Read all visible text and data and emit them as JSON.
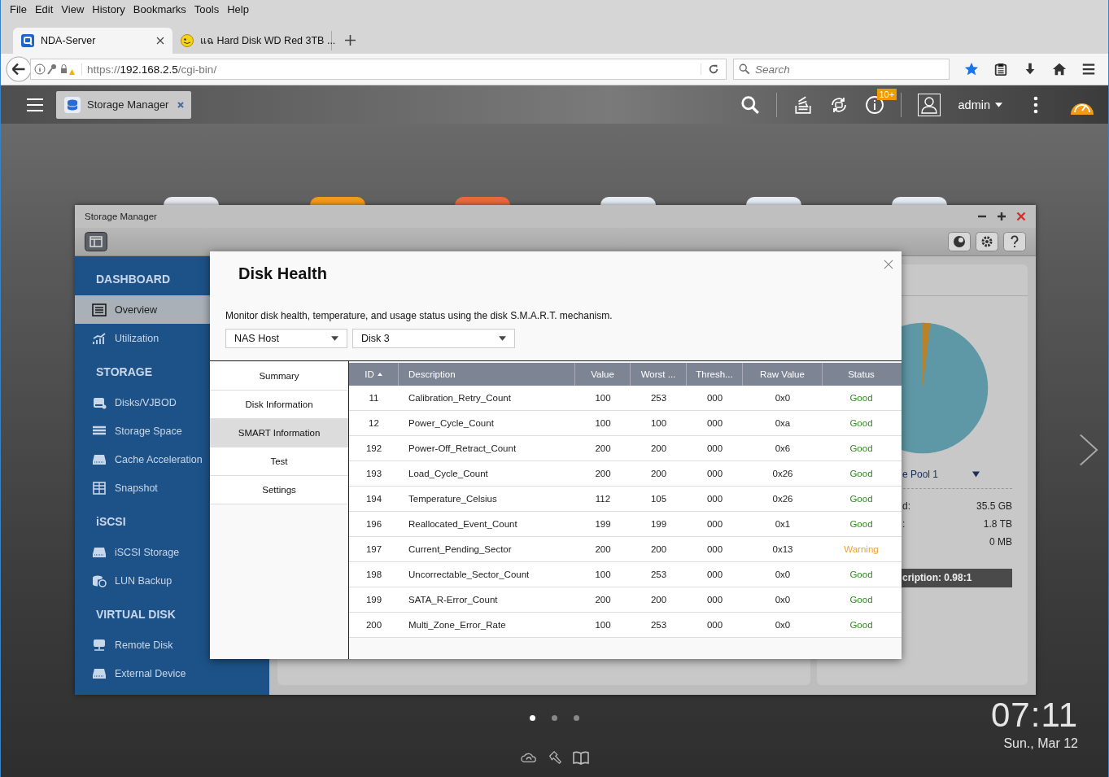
{
  "browser": {
    "menu": [
      "File",
      "Edit",
      "View",
      "History",
      "Bookmarks",
      "Tools",
      "Help"
    ],
    "tabs": [
      {
        "title": "NDA-Server",
        "selected": true
      },
      {
        "title": "แฉ Hard Disk WD Red 3TB ...",
        "selected": false
      }
    ],
    "url_scheme": "https://",
    "url_host": "192.168.2.5",
    "url_path": "/cgi-bin/",
    "search": {
      "placeholder": "Search"
    }
  },
  "topbar": {
    "app_tab": "Storage Manager",
    "notification_badge": "10+",
    "user": "admin"
  },
  "window": {
    "title": "Storage Manager",
    "sidebar": [
      {
        "title": "DASHBOARD",
        "items": [
          {
            "label": "Overview",
            "selected": true
          },
          {
            "label": "Utilization",
            "selected": false
          }
        ]
      },
      {
        "title": "STORAGE",
        "items": [
          {
            "label": "Disks/VJBOD",
            "selected": false
          },
          {
            "label": "Storage Space",
            "selected": false
          },
          {
            "label": "Cache Acceleration",
            "selected": false
          },
          {
            "label": "Snapshot",
            "selected": false
          }
        ]
      },
      {
        "title": "iSCSI",
        "items": [
          {
            "label": "iSCSI Storage",
            "selected": false
          },
          {
            "label": "LUN Backup",
            "selected": false
          }
        ]
      },
      {
        "title": "VIRTUAL DISK",
        "items": [
          {
            "label": "Remote Disk",
            "selected": false
          },
          {
            "label": "External Device",
            "selected": false
          }
        ]
      }
    ],
    "pool_panel": {
      "legend": "e Pool 1",
      "rows": [
        {
          "label": "d:",
          "value": "35.5 GB"
        },
        {
          "label": ":",
          "value": "1.8 TB"
        },
        {
          "value": "0 MB"
        }
      ],
      "ratio": "cription: 0.98:1"
    }
  },
  "dialog": {
    "title": "Disk Health",
    "description": "Monitor disk health, temperature, and usage status using the disk S.M.A.R.T. mechanism.",
    "selects": [
      "NAS Host",
      "Disk 3"
    ],
    "nav": [
      {
        "label": "Summary",
        "selected": false
      },
      {
        "label": "Disk Information",
        "selected": false
      },
      {
        "label": "SMART Information",
        "selected": true
      },
      {
        "label": "Test",
        "selected": false
      },
      {
        "label": "Settings",
        "selected": false
      }
    ],
    "columns": [
      {
        "label": "ID",
        "sorted": true
      },
      {
        "label": "Description",
        "sorted": false
      },
      {
        "label": "Value",
        "sorted": false
      },
      {
        "label": "Worst ...",
        "sorted": false
      },
      {
        "label": "Thresh...",
        "sorted": false
      },
      {
        "label": "Raw Value",
        "sorted": false
      },
      {
        "label": "Status",
        "sorted": false
      }
    ],
    "rows": [
      {
        "id": "11",
        "description": "Calibration_Retry_Count",
        "value": "100",
        "worst": "253",
        "thresh": "000",
        "raw": "0x0",
        "status": "Good",
        "color": "#2f8a1f"
      },
      {
        "id": "12",
        "description": "Power_Cycle_Count",
        "value": "100",
        "worst": "100",
        "thresh": "000",
        "raw": "0xa",
        "status": "Good",
        "color": "#2f8a1f"
      },
      {
        "id": "192",
        "description": "Power-Off_Retract_Count",
        "value": "200",
        "worst": "200",
        "thresh": "000",
        "raw": "0x6",
        "status": "Good",
        "color": "#2f8a1f"
      },
      {
        "id": "193",
        "description": "Load_Cycle_Count",
        "value": "200",
        "worst": "200",
        "thresh": "000",
        "raw": "0x26",
        "status": "Good",
        "color": "#2f8a1f"
      },
      {
        "id": "194",
        "description": "Temperature_Celsius",
        "value": "112",
        "worst": "105",
        "thresh": "000",
        "raw": "0x26",
        "status": "Good",
        "color": "#2f8a1f"
      },
      {
        "id": "196",
        "description": "Reallocated_Event_Count",
        "value": "199",
        "worst": "199",
        "thresh": "000",
        "raw": "0x1",
        "status": "Good",
        "color": "#2f8a1f"
      },
      {
        "id": "197",
        "description": "Current_Pending_Sector",
        "value": "200",
        "worst": "200",
        "thresh": "000",
        "raw": "0x13",
        "status": "Warning",
        "color": "#f0a030"
      },
      {
        "id": "198",
        "description": "Uncorrectable_Sector_Count",
        "value": "100",
        "worst": "253",
        "thresh": "000",
        "raw": "0x0",
        "status": "Good",
        "color": "#2f8a1f"
      },
      {
        "id": "199",
        "description": "SATA_R-Error_Count",
        "value": "200",
        "worst": "200",
        "thresh": "000",
        "raw": "0x0",
        "status": "Good",
        "color": "#2f8a1f"
      },
      {
        "id": "200",
        "description": "Multi_Zone_Error_Rate",
        "value": "100",
        "worst": "253",
        "thresh": "000",
        "raw": "0x0",
        "status": "Good",
        "color": "#2f8a1f"
      }
    ]
  },
  "desktop": {
    "pages": [
      {
        "selected": true
      },
      {
        "selected": false
      },
      {
        "selected": false
      }
    ],
    "clock": "07:11",
    "date": "Sun., Mar 12"
  }
}
